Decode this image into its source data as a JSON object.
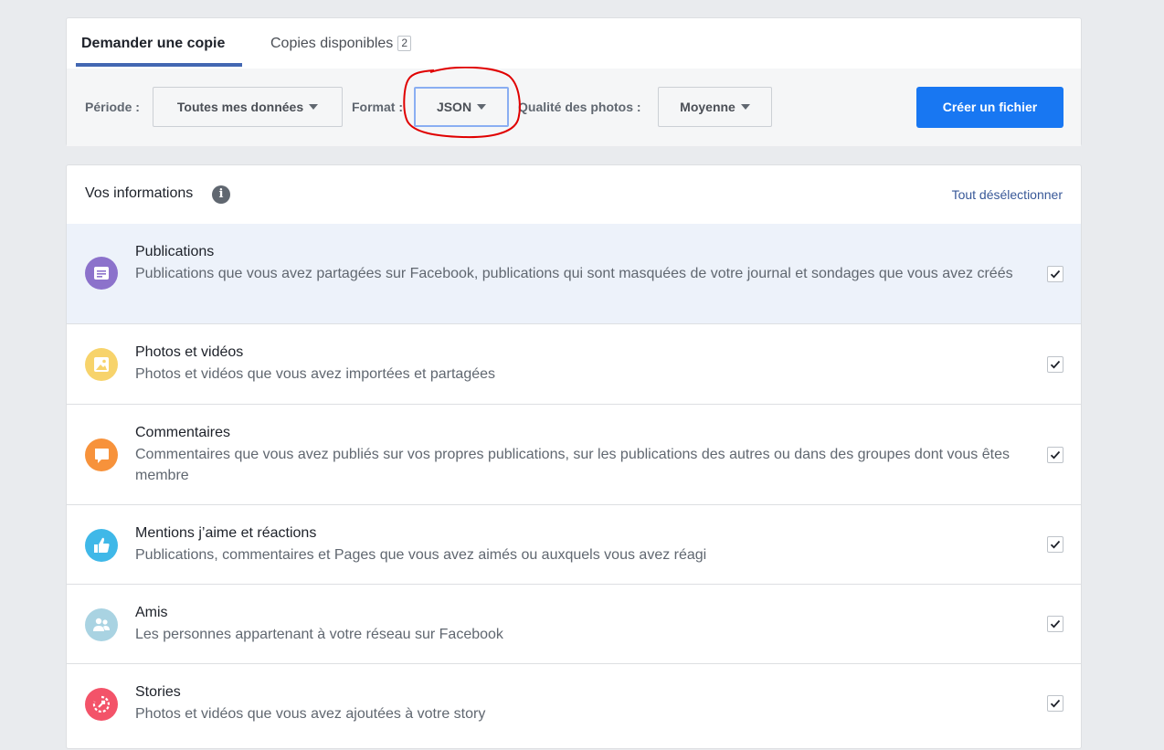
{
  "tabs": [
    {
      "label": "Demander une copie"
    },
    {
      "label": "Copies disponibles",
      "badge": "2"
    }
  ],
  "toolbar": {
    "period_label": "Période :",
    "period_value": "Toutes mes données",
    "format_label": "Format :",
    "format_value": "JSON",
    "quality_label": "Qualité des photos :",
    "quality_value": "Moyenne",
    "create_button": "Créer un fichier"
  },
  "info": {
    "title": "Vos informations",
    "info_icon": "i",
    "deselect_all": "Tout désélectionner",
    "items": [
      {
        "title": "Publications",
        "description": "Publications que vous avez partagées sur Facebook, publications qui sont masquées de votre journal et sondages que vous avez créés",
        "icon": "posts-icon",
        "color": "#8c72cb",
        "checked": true
      },
      {
        "title": "Photos et vidéos",
        "description": "Photos et vidéos que vous avez importées et partagées",
        "icon": "photos-icon",
        "color": "#f7d36b",
        "checked": true
      },
      {
        "title": "Commentaires",
        "description": "Commentaires que vous avez publiés sur vos propres publications, sur les publications des autres ou dans des groupes dont vous êtes membre",
        "icon": "comment-icon",
        "color": "#f7923b",
        "checked": true
      },
      {
        "title": "Mentions j’aime et réactions",
        "description": "Publications, commentaires et Pages que vous avez aimés ou auxquels vous avez réagi",
        "icon": "like-icon",
        "color": "#3fb8e8",
        "checked": true
      },
      {
        "title": "Amis",
        "description": "Les personnes appartenant à votre réseau sur Facebook",
        "icon": "friends-icon",
        "color": "#a9d3e2",
        "checked": true
      },
      {
        "title": "Stories",
        "description": "Photos et vidéos que vous avez ajoutées à votre story",
        "icon": "stories-icon",
        "color": "#f35369",
        "checked": true
      }
    ]
  }
}
